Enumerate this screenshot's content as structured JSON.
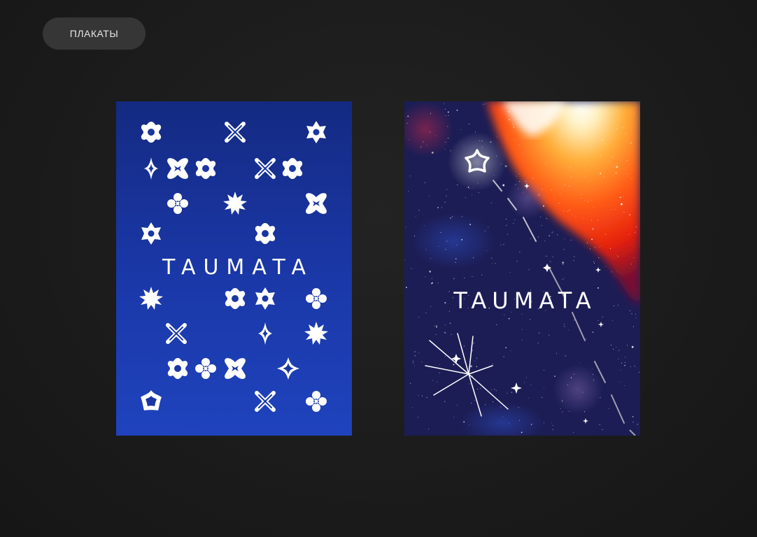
{
  "tag_label": "ПЛАКАТЫ",
  "posters": [
    {
      "title": "TAUMATA"
    },
    {
      "title": "TAUMATA"
    }
  ],
  "colors": {
    "page_background": "#1b1b1b",
    "pill_background": "#363636",
    "blue_poster_top": "#142a82",
    "blue_poster_bottom": "#1f43bd",
    "space_poster_base": "#1b1c52",
    "nebula_red": "#ff3a12",
    "nebula_orange": "#ff9a1c",
    "glyph_color": "#ffffff"
  },
  "icons": [
    "flower-icon",
    "cross-icon",
    "sparkle-icon",
    "star-icon",
    "burst-icon",
    "clover-icon",
    "asterisk-icon"
  ]
}
